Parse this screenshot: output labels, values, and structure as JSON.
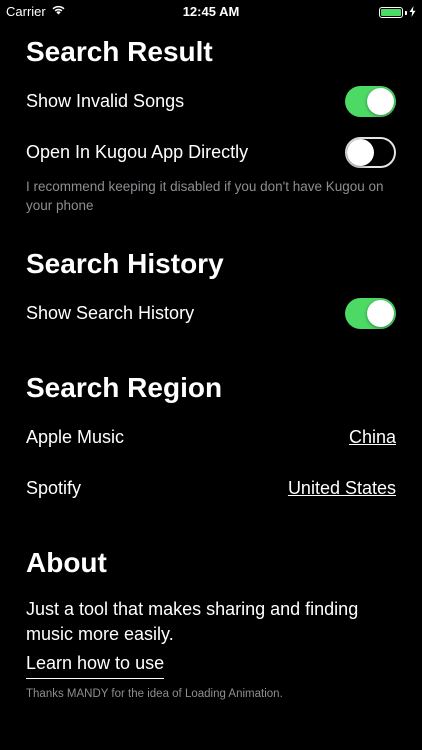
{
  "status_bar": {
    "carrier": "Carrier",
    "time": "12:45 AM",
    "wifi_icon": "wifi-icon",
    "battery_icon": "battery-icon",
    "charging_icon": "charging-bolt-icon",
    "battery_color": "#4cd964"
  },
  "search_result": {
    "title": "Search Result",
    "show_invalid_label": "Show Invalid Songs",
    "show_invalid_on": true,
    "open_kugou_label": "Open In Kugou App Directly",
    "open_kugou_on": false,
    "note": "I recommend keeping it disabled if you don't have Kugou on your phone"
  },
  "search_history": {
    "title": "Search History",
    "show_history_label": "Show Search History",
    "show_history_on": true
  },
  "search_region": {
    "title": "Search Region",
    "apple_music_label": "Apple Music",
    "apple_music_value": "China",
    "spotify_label": "Spotify",
    "spotify_value": "United States"
  },
  "about": {
    "title": "About",
    "description": "Just a tool that makes sharing and finding music more easily.",
    "learn_link": "Learn how to use",
    "credits": "Thanks MANDY for the idea of Loading Animation."
  },
  "colors": {
    "background": "#000000",
    "toggle_on": "#4cd964",
    "secondary_text": "#8e8e93"
  }
}
